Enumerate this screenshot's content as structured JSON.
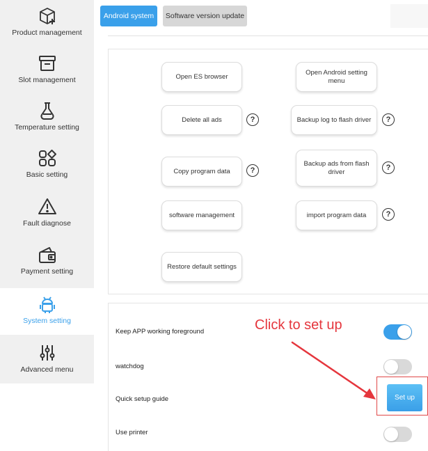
{
  "sidebar": {
    "items": [
      {
        "label": "Product management",
        "icon": "box-plus-icon"
      },
      {
        "label": "Slot management",
        "icon": "archive-box-icon"
      },
      {
        "label": "Temperature setting",
        "icon": "flask-icon"
      },
      {
        "label": "Basic setting",
        "icon": "shapes-grid-icon"
      },
      {
        "label": "Fault diagnose",
        "icon": "warning-triangle-icon"
      },
      {
        "label": "Payment setting",
        "icon": "wallet-icon"
      },
      {
        "label": "System setting",
        "icon": "android-robot-icon"
      },
      {
        "label": "Advanced menu",
        "icon": "sliders-icon"
      }
    ],
    "active_index": 6
  },
  "tabs": [
    {
      "label": "Android system",
      "active": true
    },
    {
      "label": "Software version update",
      "active": false
    }
  ],
  "buttons": {
    "open_es": "Open ES browser",
    "open_android": "Open Android setting menu",
    "delete_ads": "Delete all ads",
    "backup_log": "Backup log to flash driver",
    "copy_program": "Copy program data",
    "backup_ads": "Backup ads from flash driver",
    "software_mgmt": "software management",
    "import_program": "import program data",
    "restore_default": "Restore default settings",
    "help_glyph": "?"
  },
  "settings": [
    {
      "label": "Keep APP working foreground",
      "control": "toggle",
      "on": true
    },
    {
      "label": "watchdog",
      "control": "toggle",
      "on": false
    },
    {
      "label": "Quick setup guide",
      "control": "button",
      "button_label": "Set up"
    },
    {
      "label": "Use printer",
      "control": "toggle",
      "on": false
    }
  ],
  "annotation": {
    "text": "Click to set up",
    "color": "#e5363d"
  },
  "colors": {
    "accent": "#3aa0ea",
    "sidebar_bg": "#f0f0f0",
    "annotation": "#e5363d"
  }
}
